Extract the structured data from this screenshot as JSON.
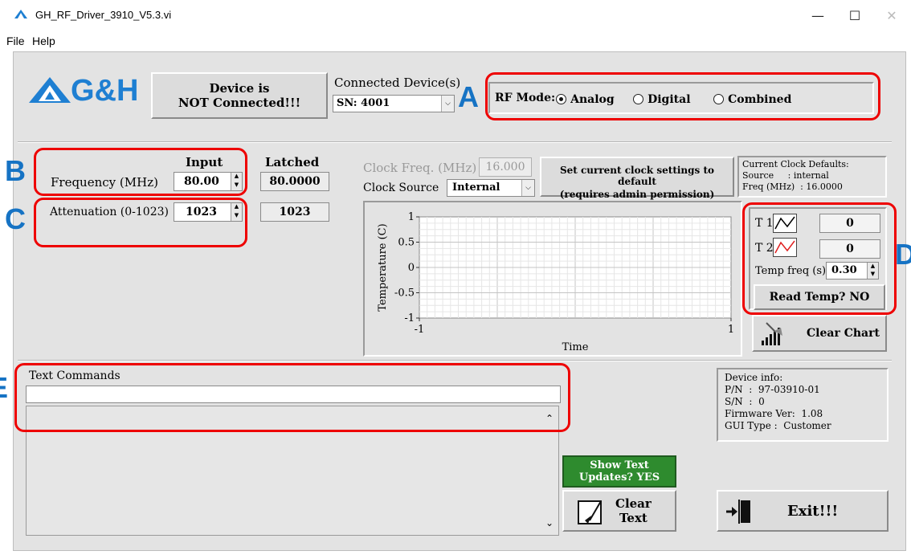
{
  "window": {
    "title": "GH_RF_Driver_3910_V5.3.vi",
    "minimize": "—",
    "maximize": "☐",
    "close": "✕"
  },
  "menu": [
    "File",
    "Help"
  ],
  "logo": "G&H",
  "connection": {
    "status_line1": "Device is",
    "status_line2": "NOT Connected!!!",
    "devices_label": "Connected Device(s)",
    "device_value": "SN: 4001"
  },
  "rf_mode": {
    "label": "RF Mode:",
    "options": [
      "Analog",
      "Digital",
      "Combined"
    ],
    "selected": "Analog"
  },
  "callouts": {
    "a": "A",
    "b": "B",
    "c": "C",
    "d": "D",
    "e": "E"
  },
  "inputs": {
    "input_header": "Input",
    "latched_header": "Latched",
    "frequency_label": "Frequency (MHz)",
    "frequency_input": "80.00",
    "frequency_latched": "80.0000",
    "attenuation_label": "Attenuation (0-1023)",
    "attenuation_input": "1023",
    "attenuation_latched": "1023"
  },
  "clock": {
    "freq_label": "Clock Freq. (MHz)",
    "freq_value": "16.000",
    "source_label": "Clock Source",
    "source_value": "Internal",
    "default_button_line1": "Set current clock settings to default",
    "default_button_line2": "(requires admin permission)",
    "defaults_title": "Current Clock Defaults:",
    "defaults_source": "Source     : internal",
    "defaults_freq": "Freq (MHz)  : 16.0000"
  },
  "chart_data": {
    "type": "line",
    "ylabel": "Temperature (C)",
    "xlabel": "Time",
    "x_ticks": [
      "-1",
      "1"
    ],
    "y_ticks": [
      "1",
      "0.5",
      "0",
      "-0.5",
      "-1"
    ],
    "xlim": [
      -1,
      1
    ],
    "ylim": [
      -1,
      1
    ],
    "grid": true,
    "series": []
  },
  "temps": {
    "t1_label": "T 1",
    "t1_value": "0",
    "t1_color": "#000000",
    "t2_label": "T 2",
    "t2_value": "0",
    "t2_color": "#e02020",
    "freq_label": "Temp freq (s)",
    "freq_value": "0.30",
    "read_button": "Read Temp? NO",
    "clear_chart": "Clear Chart"
  },
  "text_commands": {
    "label": "Text Commands",
    "input_value": "",
    "output_value": ""
  },
  "device_info": {
    "title": "Device info:",
    "pn": "P/N  :  97-03910-01",
    "sn": "S/N  :  0",
    "firmware": "Firmware Ver:  1.08",
    "gui_type": "GUI Type :  Customer"
  },
  "buttons": {
    "show_text_line1": "Show Text",
    "show_text_line2": "Updates? YES",
    "show_text_color": "#2e8b2e",
    "clear_text_line1": "Clear",
    "clear_text_line2": "Text",
    "exit": "Exit!!!"
  }
}
